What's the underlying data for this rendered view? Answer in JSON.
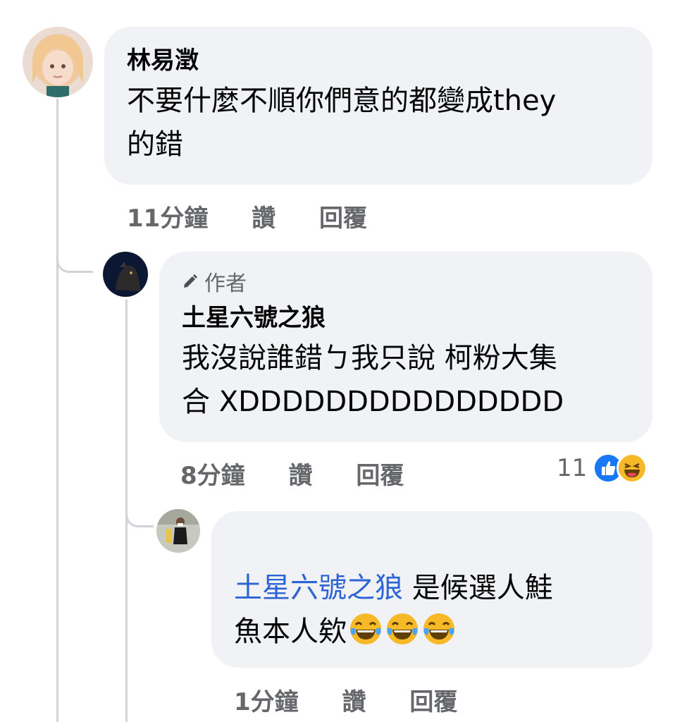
{
  "comments": [
    {
      "author": "林易澂",
      "text_lines": [
        "不要什麼不順你們意的都變成they",
        "的錯"
      ],
      "time": "11分鐘",
      "like_label": "讚",
      "reply_label": "回覆"
    },
    {
      "author_badge": "作者",
      "author": "土星六號之狼",
      "text_lines": [
        "我沒說誰錯ㄅ我只說 柯粉大集",
        "合 XDDDDDDDDDDDDDDD"
      ],
      "time": "8分鐘",
      "like_label": "讚",
      "reply_label": "回覆",
      "reaction_count": "11",
      "reaction_icons": [
        "like-icon",
        "haha-icon"
      ]
    },
    {
      "author": "",
      "mention": "土星六號之狼",
      "text_after_mention": " 是候選人鮭",
      "text_line2": "魚本人欸",
      "emojis": [
        "tears-of-joy-emoji",
        "tears-of-joy-emoji",
        "tears-of-joy-emoji"
      ],
      "time": "1分鐘",
      "like_label": "讚",
      "reply_label": "回覆"
    }
  ],
  "colors": {
    "bubble": "#f0f2f5",
    "meta_text": "#65676b",
    "mention": "#2c64d6",
    "like_blue": "#1877f2",
    "haha_yellow": "#f7b928"
  }
}
